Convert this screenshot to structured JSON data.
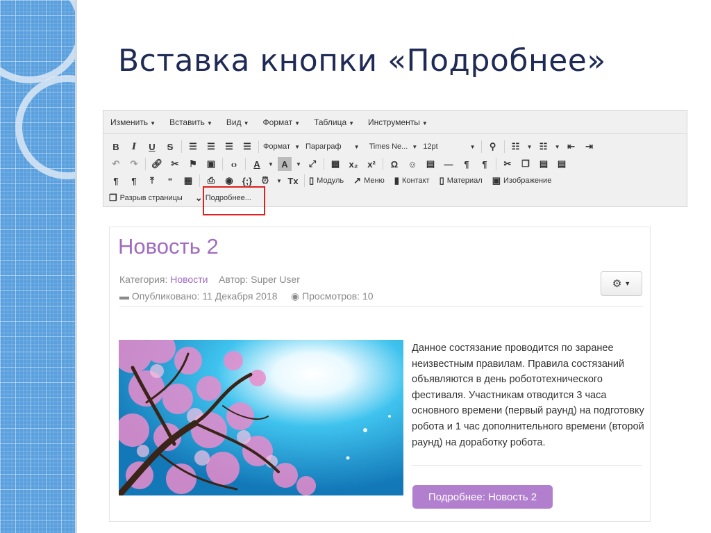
{
  "slide": {
    "title": "Вставка кнопки «Подробнее»"
  },
  "editor": {
    "menus": [
      "Изменить",
      "Вставить",
      "Вид",
      "Формат",
      "Таблица",
      "Инструменты"
    ],
    "row1": {
      "format_select": "Формат",
      "paragraph_select": "Параграф",
      "font_select": "Times Ne...",
      "size_select": "12pt"
    },
    "row3_buttons": {
      "module": "Модуль",
      "menu": "Меню",
      "contact": "Контакт",
      "article": "Материал",
      "image": "Изображение"
    },
    "row4_buttons": {
      "page_break": "Разрыв страницы",
      "read_more": "Подробнее..."
    }
  },
  "article": {
    "title": "Новость 2",
    "category_label": "Категория:",
    "category_value": "Новости",
    "author_label": "Автор: Super User",
    "published": "Опубликовано: 11 Декабря 2018",
    "views": "Просмотров: 10",
    "text": "Данное состязание проводится по заранее неизвестным правилам. Правила состязаний объявляются в день робототехнического фестиваля. Участникам отводится 3 часа основного времени (первый раунд) на подготовку робота и 1 час дополнительного времени (второй раунд) на доработку робота.",
    "read_more_button": "Подробнее: Новость 2"
  },
  "colors": {
    "title": "#1f2a55",
    "article_accent": "#a06cc0",
    "button_bg": "#b27fcf",
    "highlight_box": "#e02020",
    "deco_blue": "#5aa0de"
  }
}
